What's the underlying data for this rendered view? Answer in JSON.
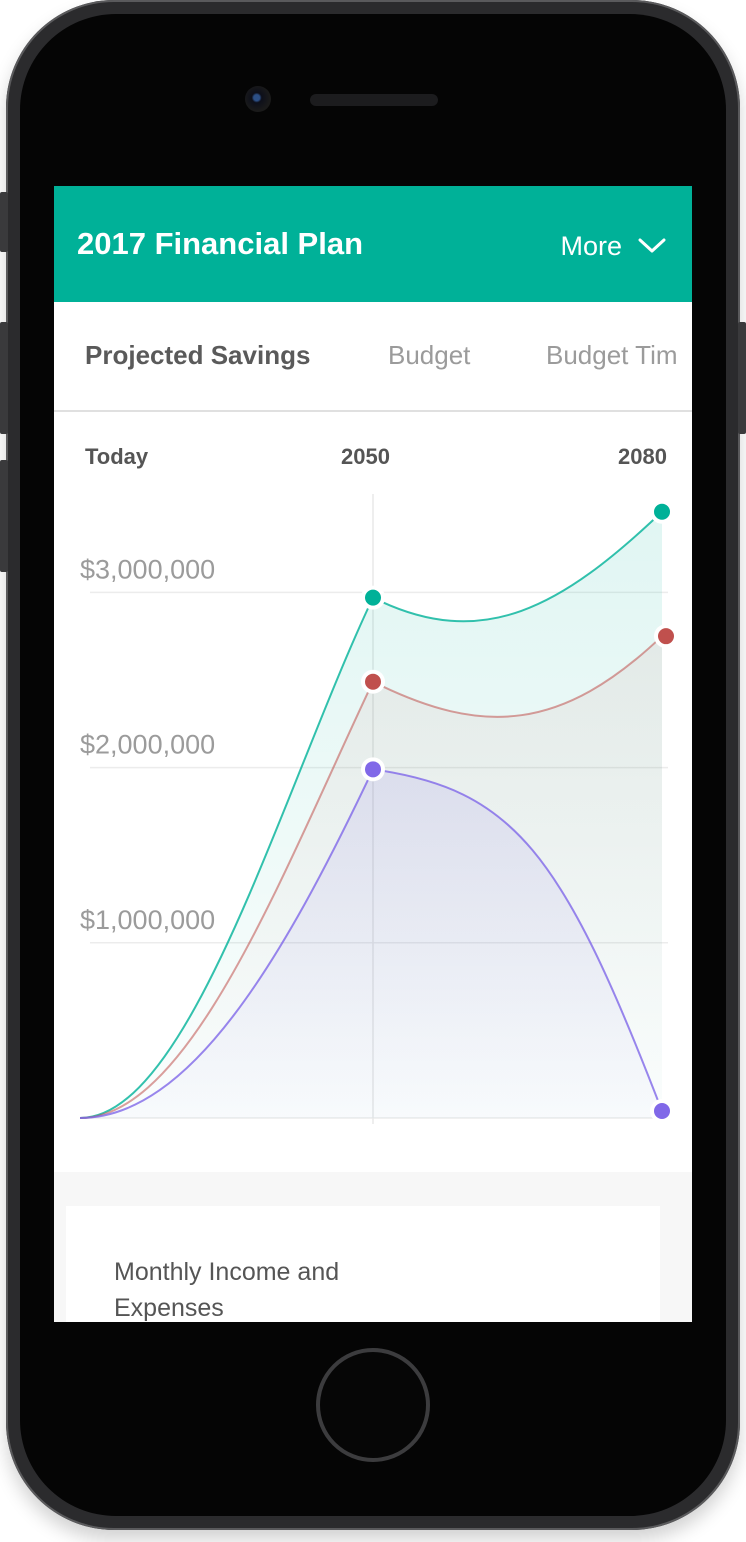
{
  "header": {
    "title": "2017 Financial Plan",
    "more_label": "More"
  },
  "tabs": [
    {
      "label": "Projected Savings",
      "active": true
    },
    {
      "label": "Budget",
      "active": false
    },
    {
      "label": "Budget Tim",
      "active": false
    }
  ],
  "timeline": {
    "today": "Today",
    "mid": "2050",
    "end": "2080"
  },
  "chart_data": {
    "type": "area",
    "x_labels": [
      "Today",
      "2050",
      "2080"
    ],
    "y_tick_labels": [
      "$3,000,000",
      "$2,000,000",
      "$1,000,000"
    ],
    "y_ticks": [
      3000000,
      2000000,
      1000000
    ],
    "ylim": [
      0,
      3550000
    ],
    "grid": true,
    "series": [
      {
        "color": "#00b198",
        "values": [
          0,
          2970000,
          3460000
        ]
      },
      {
        "color": "#c0504d",
        "values": [
          0,
          2490000,
          2750000
        ]
      },
      {
        "color": "#8068e8",
        "values": [
          0,
          1990000,
          40000
        ]
      }
    ]
  },
  "card": {
    "title": "Monthly Income and Expenses"
  }
}
